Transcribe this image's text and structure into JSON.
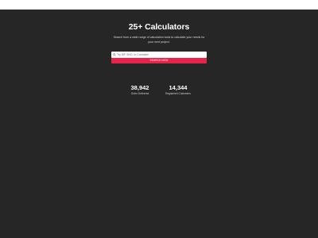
{
  "hero": {
    "title": "25+ Calculators",
    "subtitle": "Search from a wide range of calculation tools to calculate your needs for your next project."
  },
  "search": {
    "placeholder": "Try DIF SNO, or Cornoeler",
    "button_label": "SEARCH NOW",
    "icon": "search-icon"
  },
  "stats": [
    {
      "value": "38,942",
      "label": "Order Delivered"
    },
    {
      "value": "14,344",
      "label": "Registered Customers"
    }
  ],
  "colors": {
    "background": "#262626",
    "accent": "#e8234a",
    "text": "#ffffff"
  }
}
